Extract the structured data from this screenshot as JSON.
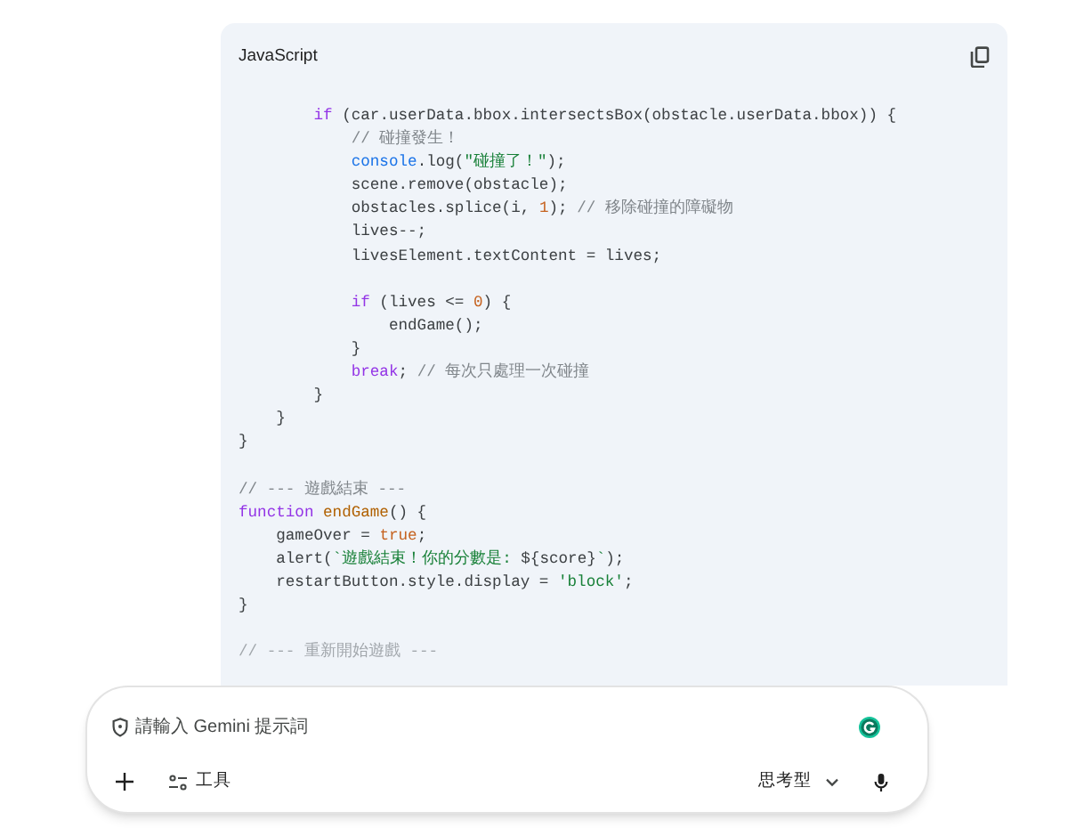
{
  "code_block": {
    "language": "JavaScript",
    "lines": [
      {
        "kind": "code",
        "tokens": [
          {
            "kind": "kw",
            "s": "        if"
          },
          {
            "kind": "plain",
            "s": " (car.userData.bbox.intersectsBox(obstacle.userData.bbox)) {"
          }
        ]
      },
      {
        "kind": "code",
        "tokens": [
          {
            "kind": "comment",
            "s": "            // 碰撞發生！"
          }
        ]
      },
      {
        "kind": "code",
        "tokens": [
          {
            "kind": "obj",
            "s": "            console"
          },
          {
            "kind": "plain",
            "s": ".log("
          },
          {
            "kind": "str",
            "s": "\"碰撞了！\""
          },
          {
            "kind": "plain",
            "s": ");"
          }
        ]
      },
      {
        "kind": "code",
        "tokens": [
          {
            "kind": "plain",
            "s": "            scene.remove(obstacle);"
          }
        ]
      },
      {
        "kind": "code",
        "tokens": [
          {
            "kind": "plain",
            "s": "            obstacles.splice(i, "
          },
          {
            "kind": "num",
            "s": "1"
          },
          {
            "kind": "plain",
            "s": "); "
          },
          {
            "kind": "comment",
            "s": "// 移除碰撞的障礙物"
          }
        ]
      },
      {
        "kind": "code",
        "tokens": [
          {
            "kind": "plain",
            "s": "            lives--;"
          }
        ]
      },
      {
        "kind": "code",
        "tokens": [
          {
            "kind": "plain",
            "s": "            livesElement.textContent = lives;"
          }
        ]
      },
      {
        "kind": "blank"
      },
      {
        "kind": "code",
        "tokens": [
          {
            "kind": "kw",
            "s": "            if"
          },
          {
            "kind": "plain",
            "s": " (lives <= "
          },
          {
            "kind": "num",
            "s": "0"
          },
          {
            "kind": "plain",
            "s": ") {"
          }
        ]
      },
      {
        "kind": "code",
        "tokens": [
          {
            "kind": "plain",
            "s": "                endGame();"
          }
        ]
      },
      {
        "kind": "code",
        "tokens": [
          {
            "kind": "plain",
            "s": "            }"
          }
        ]
      },
      {
        "kind": "code",
        "tokens": [
          {
            "kind": "kw",
            "s": "            break"
          },
          {
            "kind": "plain",
            "s": "; "
          },
          {
            "kind": "comment",
            "s": "// 每次只處理一次碰撞"
          }
        ]
      },
      {
        "kind": "code",
        "tokens": [
          {
            "kind": "plain",
            "s": "        }"
          }
        ]
      },
      {
        "kind": "code",
        "tokens": [
          {
            "kind": "plain",
            "s": "    }"
          }
        ]
      },
      {
        "kind": "code",
        "tokens": [
          {
            "kind": "plain",
            "s": "}"
          }
        ]
      },
      {
        "kind": "blank"
      },
      {
        "kind": "code",
        "tokens": [
          {
            "kind": "comment",
            "s": "// --- 遊戲結束 ---"
          }
        ]
      },
      {
        "kind": "code",
        "tokens": [
          {
            "kind": "kw",
            "s": "function"
          },
          {
            "kind": "fn",
            "s": " endGame"
          },
          {
            "kind": "plain",
            "s": "() {"
          }
        ]
      },
      {
        "kind": "code",
        "tokens": [
          {
            "kind": "plain",
            "s": "    gameOver = "
          },
          {
            "kind": "num",
            "s": "true"
          },
          {
            "kind": "plain",
            "s": ";"
          }
        ]
      },
      {
        "kind": "code",
        "tokens": [
          {
            "kind": "plain",
            "s": "    alert("
          },
          {
            "kind": "str",
            "s": "`遊戲結束！你的分數是: "
          },
          {
            "kind": "plain",
            "s": "${score}"
          },
          {
            "kind": "str",
            "s": "`"
          },
          {
            "kind": "plain",
            "s": ");"
          }
        ]
      },
      {
        "kind": "code",
        "tokens": [
          {
            "kind": "plain",
            "s": "    restartButton.style.display = "
          },
          {
            "kind": "str",
            "s": "'block'"
          },
          {
            "kind": "plain",
            "s": ";"
          }
        ]
      },
      {
        "kind": "code",
        "tokens": [
          {
            "kind": "plain",
            "s": "}"
          }
        ]
      },
      {
        "kind": "blank"
      },
      {
        "kind": "faded",
        "tokens": [
          {
            "kind": "comment",
            "s": "// --- 重新開始遊戲 ---"
          }
        ]
      }
    ]
  },
  "prompt_box": {
    "placeholder": "請輸入 Gemini 提示詞",
    "tools_label": "工具",
    "mode": "思考型"
  }
}
